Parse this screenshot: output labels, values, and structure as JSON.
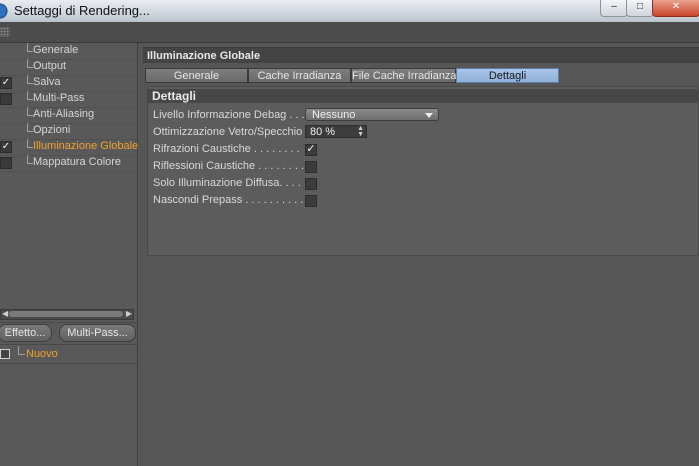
{
  "window": {
    "title": "Settaggi di Rendering..."
  },
  "sidebar": {
    "items": [
      {
        "label": "Generale",
        "checked": false,
        "has_checkbox": false,
        "active": false
      },
      {
        "label": "Output",
        "checked": false,
        "has_checkbox": false,
        "active": false
      },
      {
        "label": "Salva",
        "checked": true,
        "has_checkbox": true,
        "active": false
      },
      {
        "label": "Multi-Pass",
        "checked": false,
        "has_checkbox": true,
        "active": false
      },
      {
        "label": "Anti-Aliasing",
        "checked": false,
        "has_checkbox": false,
        "active": false
      },
      {
        "label": "Opzioni",
        "checked": false,
        "has_checkbox": false,
        "active": false
      },
      {
        "label": "Illuminazione Globale",
        "checked": true,
        "has_checkbox": true,
        "active": true
      },
      {
        "label": "Mappatura Colore",
        "checked": false,
        "has_checkbox": true,
        "active": false
      }
    ],
    "buttons": {
      "effect": "Effetto...",
      "multipass": "Multi-Pass..."
    },
    "preset": {
      "label": "Nuovo"
    }
  },
  "main": {
    "section_title": "Illuminazione Globale",
    "tabs": [
      {
        "label": "Generale",
        "active": false
      },
      {
        "label": "Cache Irradianza",
        "active": false
      },
      {
        "label": "File Cache Irradianza",
        "active": false
      },
      {
        "label": "Dettagli",
        "active": true
      }
    ],
    "group_title": "Dettagli",
    "fields": {
      "debug_level": {
        "label": "Livello Informazione Debag . . .",
        "value": "Nessuno"
      },
      "glass_optimization": {
        "label": "Ottimizzazione  Vetro/Specchio",
        "value": "80 %"
      },
      "refraction_caustics": {
        "label": "Rifrazioni Caustiche . . . . . . . .",
        "checked": true
      },
      "reflection_caustics": {
        "label": "Riflessioni Caustiche  . . . . . . . .",
        "checked": false
      },
      "diffuse_only": {
        "label": "Solo Illuminazione Diffusa. . . . .",
        "checked": false
      },
      "hide_prepass": {
        "label": "Nascondi Prepass  . . . . . . . . . .",
        "checked": false
      }
    }
  },
  "icons": {
    "check": "✓",
    "app": "cinema4d-icon",
    "grid": "grip-icon"
  }
}
